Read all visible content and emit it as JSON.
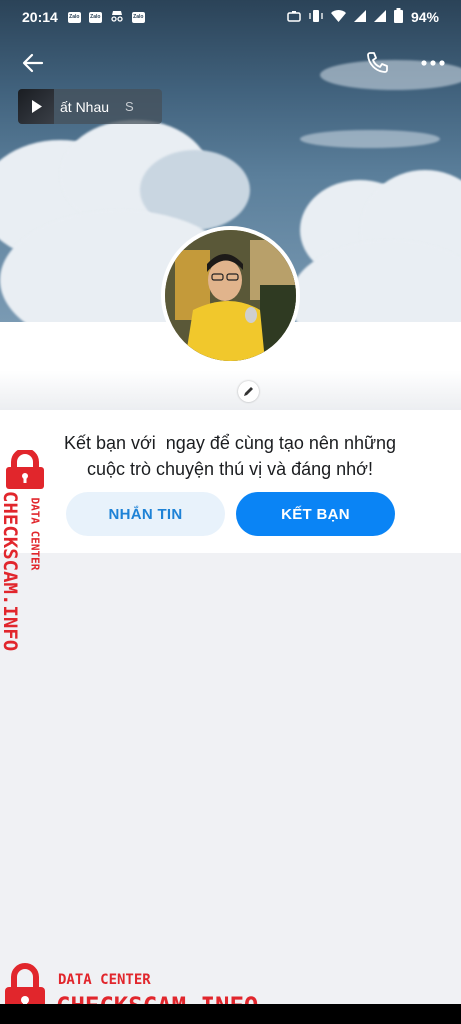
{
  "status_bar": {
    "time": "20:14",
    "battery": "94%",
    "apps": [
      "Zalo",
      "Zalo",
      "Zalo"
    ]
  },
  "music": {
    "title": "ất Nhau",
    "extra": "S"
  },
  "friend_prompt": {
    "line1": "Kết bạn với  ngay để cùng tạo nên những",
    "line2": "cuộc trò chuyện thú vị và đáng nhớ!"
  },
  "buttons": {
    "message": "NHẮN TIN",
    "add_friend": "KẾT BẠN"
  },
  "watermark": {
    "small": "DATA CENTER",
    "big": "CHECKSCAM.INFO"
  },
  "colors": {
    "accent": "#0a84f5",
    "watermark": "#e1262c"
  }
}
